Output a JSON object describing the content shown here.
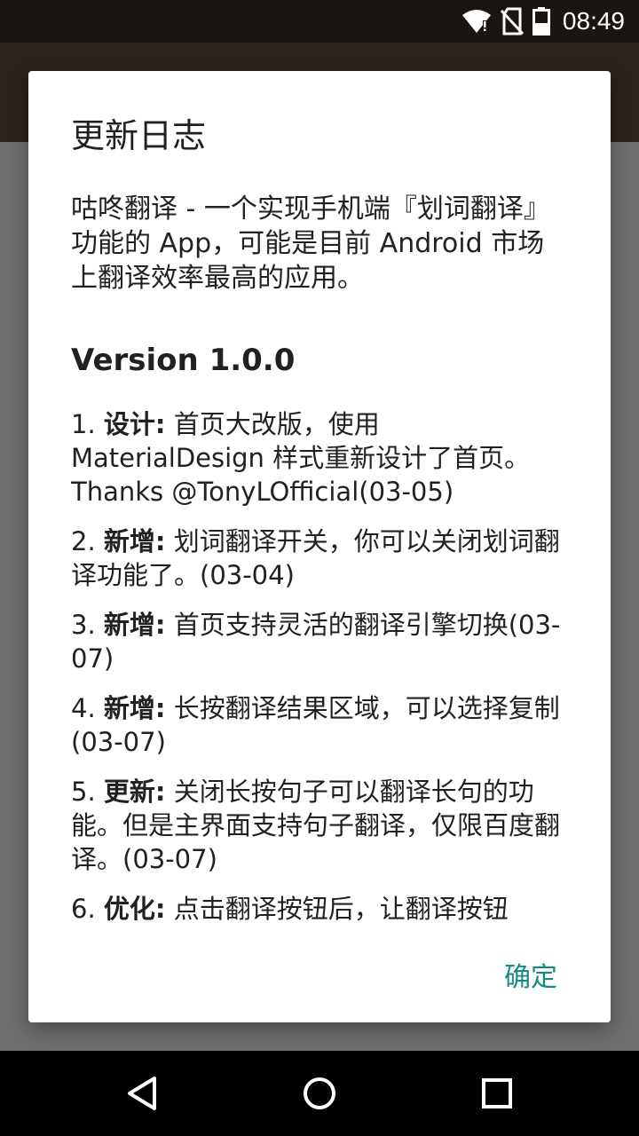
{
  "status_bar": {
    "time": "08:49",
    "icons": [
      "wifi-icon",
      "no-sim-icon",
      "battery-icon"
    ]
  },
  "dialog": {
    "title": "更新日志",
    "intro": "咕咚翻译 - 一个实现手机端『划词翻译』功能的 App，可能是目前 Android 市场上翻译效率最高的应用。",
    "version_title": "Version 1.0.0",
    "changes": [
      {
        "number": "1.",
        "tag": "设计:",
        "text": "首页大改版，使用 MaterialDesign 样式重新设计了首页。Thanks @TonyLOfficial(03-05)"
      },
      {
        "number": "2.",
        "tag": "新增:",
        "text": "划词翻译开关，你可以关闭划词翻译功能了。(03-04)"
      },
      {
        "number": "3.",
        "tag": "新增:",
        "text": "首页支持灵活的翻译引擎切换(03-07)"
      },
      {
        "number": "4.",
        "tag": "新增:",
        "text": "长按翻译结果区域，可以选择复制(03-07)"
      },
      {
        "number": "5.",
        "tag": "更新:",
        "text": "关闭长按句子可以翻译长句的功能。但是主界面支持句子翻译，仅限百度翻译。(03-07)"
      },
      {
        "number": "6.",
        "tag": "优化:",
        "text": "点击翻译按钮后，让翻译按钮"
      }
    ],
    "ok_label": "确定"
  },
  "colors": {
    "accent": "#138a84",
    "status_bar": "#1a1412",
    "nav_bar": "#000000",
    "scrim": "#4a4542"
  },
  "nav_bar": {
    "buttons": [
      "back-icon",
      "home-icon",
      "recents-icon"
    ]
  }
}
